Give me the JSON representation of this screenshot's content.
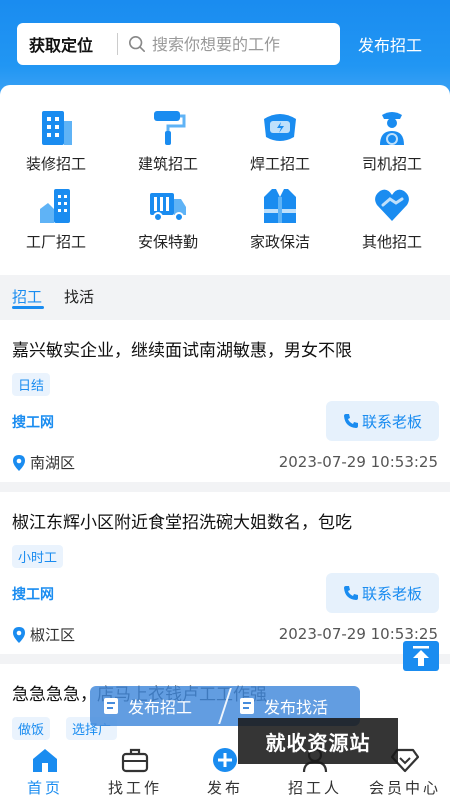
{
  "header": {
    "location_label": "获取定位",
    "search_placeholder": "搜索你想要的工作",
    "publish_label": "发布招工"
  },
  "categories": [
    {
      "label": "装修招工",
      "icon": "building-icon"
    },
    {
      "label": "建筑招工",
      "icon": "paint-roller-icon"
    },
    {
      "label": "焊工招工",
      "icon": "welding-mask-icon"
    },
    {
      "label": "司机招工",
      "icon": "driver-icon"
    },
    {
      "label": "工厂招工",
      "icon": "factory-icon"
    },
    {
      "label": "安保特勤",
      "icon": "truck-icon"
    },
    {
      "label": "家政保洁",
      "icon": "vest-icon"
    },
    {
      "label": "其他招工",
      "icon": "handshake-heart-icon"
    }
  ],
  "tabs": [
    {
      "label": "招工",
      "active": true
    },
    {
      "label": "找活",
      "active": false
    }
  ],
  "listings": [
    {
      "title": "嘉兴敏实企业，继续面试南湖敏惠，男女不限",
      "tags": [
        "日结"
      ],
      "source": "搜工网",
      "contact_label": "联系老板",
      "location": "南湖区",
      "time": "2023-07-29 10:53:25"
    },
    {
      "title": "椒江东辉小区附近食堂招洗碗大姐数名，包吃",
      "tags": [
        "小时工"
      ],
      "source": "搜工网",
      "contact_label": "联系老板",
      "location": "椒江区",
      "time": "2023-07-29 10:53:25"
    },
    {
      "title": "急急急急，店马上衣钱卢工工作强",
      "tags": [
        "做饭",
        "选择广"
      ]
    }
  ],
  "float_bar": {
    "publish_recruit": "发布招工",
    "publish_job": "发布找活"
  },
  "watermark": "就收资源站",
  "bottom_nav": [
    {
      "label": "首页",
      "icon": "home-icon",
      "active": true
    },
    {
      "label": "找工作",
      "icon": "briefcase-icon",
      "active": false
    },
    {
      "label": "发布",
      "icon": "plus-circle-icon",
      "active": false
    },
    {
      "label": "招工人",
      "icon": "person-icon",
      "active": false
    },
    {
      "label": "会员中心",
      "icon": "diamond-icon",
      "active": false
    }
  ],
  "colors": {
    "accent": "#1a8cf0",
    "tag_bg": "#eaf3fd",
    "header_bg": "#2196f3"
  }
}
